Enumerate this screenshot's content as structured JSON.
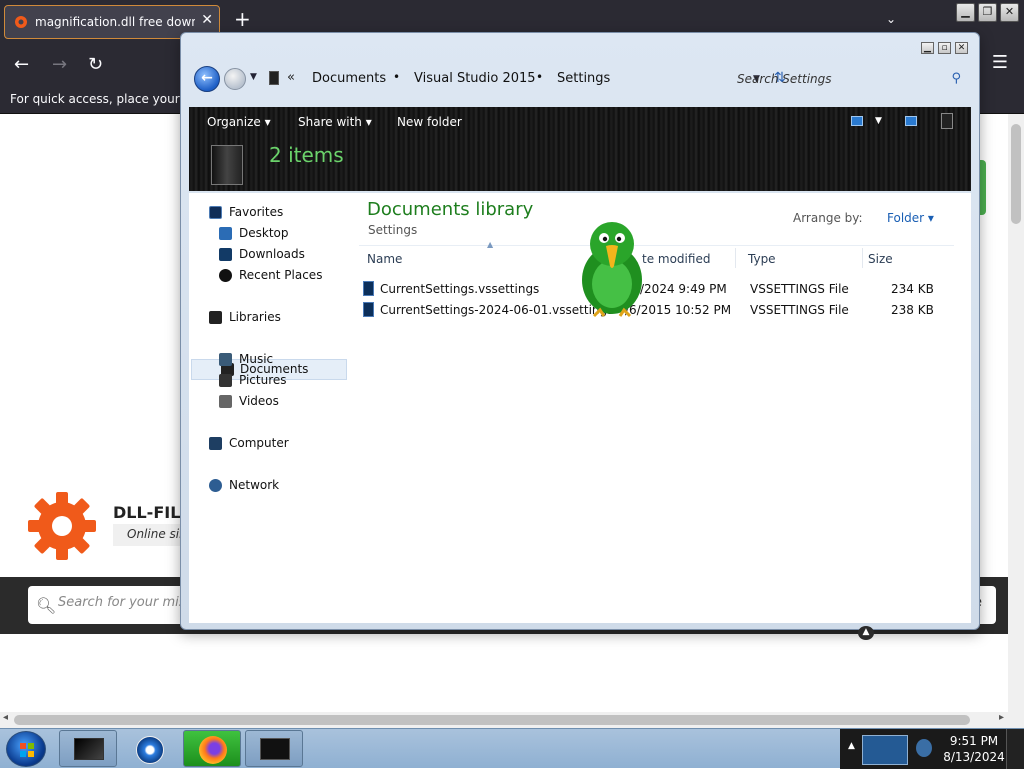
{
  "browser": {
    "tab_title": "magnification.dll free download",
    "tab_close": "✕",
    "new_tab": "+",
    "tab_list": "⌄",
    "bookmarks_hint": "For quick access, place your boo",
    "window_controls": {
      "minimize": "▁",
      "restore": "❐",
      "close": "✕"
    }
  },
  "site": {
    "name": "DLL-FILE",
    "tagline": "Online sin",
    "search_placeholder": "Search for your missi",
    "search_button_partial": "e"
  },
  "explorer": {
    "breadcrumb": [
      "Documents",
      "Visual Studio 2015",
      "Settings"
    ],
    "breadcrumb_sep": "•",
    "breadcrumb_overflow": "«",
    "search_placeholder": "Search Settings",
    "toolbar": {
      "organize": "Organize",
      "share_with": "Share with",
      "new_folder": "New folder"
    },
    "items_count": "2 items",
    "nav": {
      "favorites": "Favorites",
      "desktop": "Desktop",
      "downloads": "Downloads",
      "recent_places": "Recent Places",
      "libraries": "Libraries",
      "documents": "Documents",
      "music": "Music",
      "pictures": "Pictures",
      "videos": "Videos",
      "computer": "Computer",
      "network": "Network"
    },
    "library_title": "Documents library",
    "library_subtitle": "Settings",
    "arrange_label": "Arrange by:",
    "arrange_value": "Folder ▾",
    "columns": {
      "name": "Name",
      "date": "te modified",
      "type": "Type",
      "size": "Size"
    },
    "files": [
      {
        "name": "CurrentSettings.vssettings",
        "date": "/2024 9:49 PM",
        "type": "VSSETTINGS File",
        "size": "234 KB"
      },
      {
        "name": "CurrentSettings-2024-06-01.vssettings",
        "date": "/6/2015 10:52 PM",
        "type": "VSSETTINGS File",
        "size": "238 KB"
      }
    ]
  },
  "taskbar": {
    "time": "9:51 PM",
    "date": "8/13/2024"
  },
  "colors": {
    "library_title": "#1e7e1e",
    "items_count": "#6bd36b",
    "site_logo": "#f05a1a"
  }
}
